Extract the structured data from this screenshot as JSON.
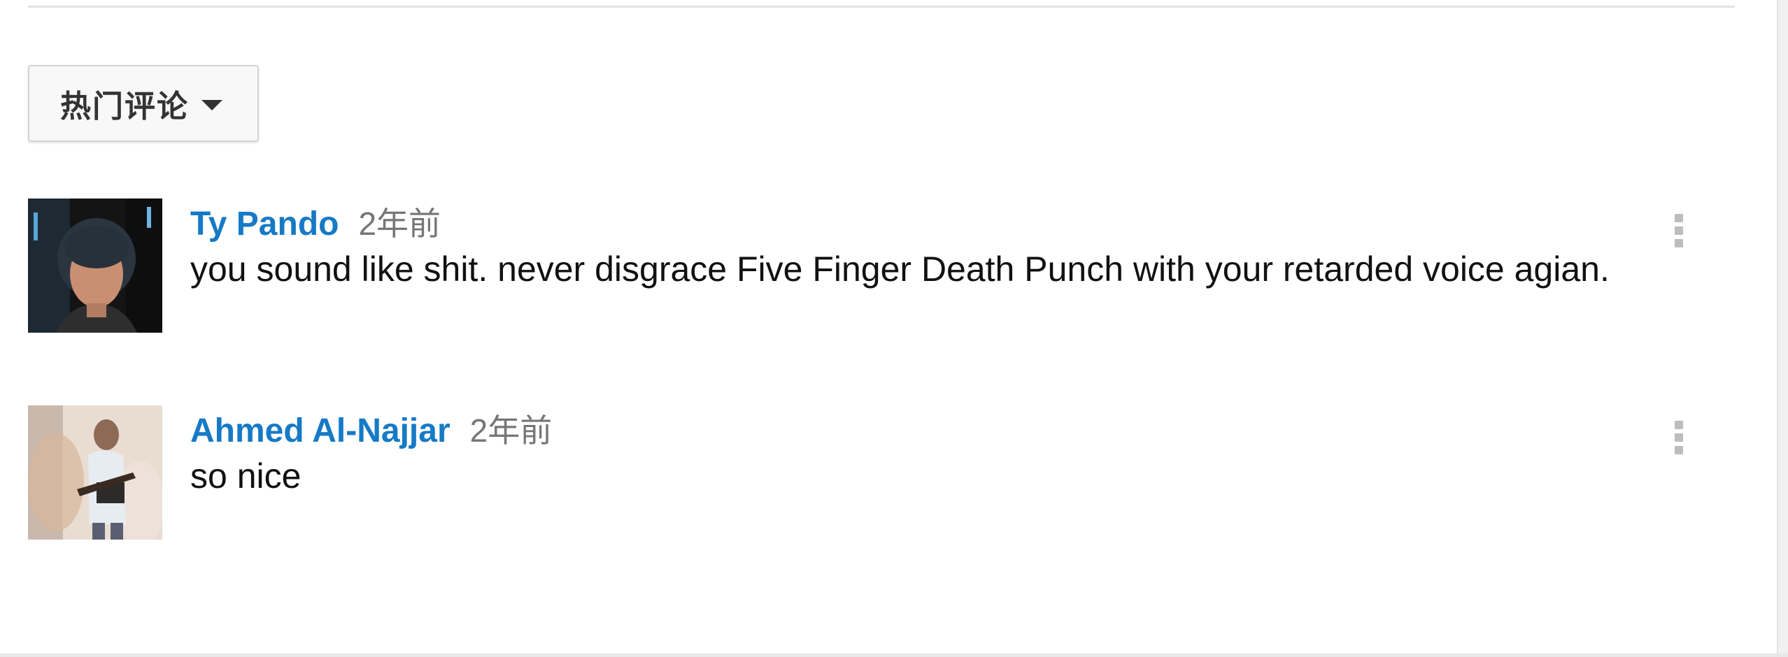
{
  "sort": {
    "label": "热门评论"
  },
  "comments": [
    {
      "author": "Ty Pando",
      "time": "2年前",
      "text": "you sound like shit. never disgrace Five Finger Death Punch with your retarded voice agian."
    },
    {
      "author": "Ahmed Al-Najjar",
      "time": "2年前",
      "text": "so nice"
    }
  ],
  "icons": [
    "caret-down-icon",
    "more-vertical-icon"
  ],
  "colors": {
    "author_link": "#167ac6",
    "timestamp": "#767676",
    "body_text": "#111111",
    "menu_dots": "#bdbdbd"
  }
}
